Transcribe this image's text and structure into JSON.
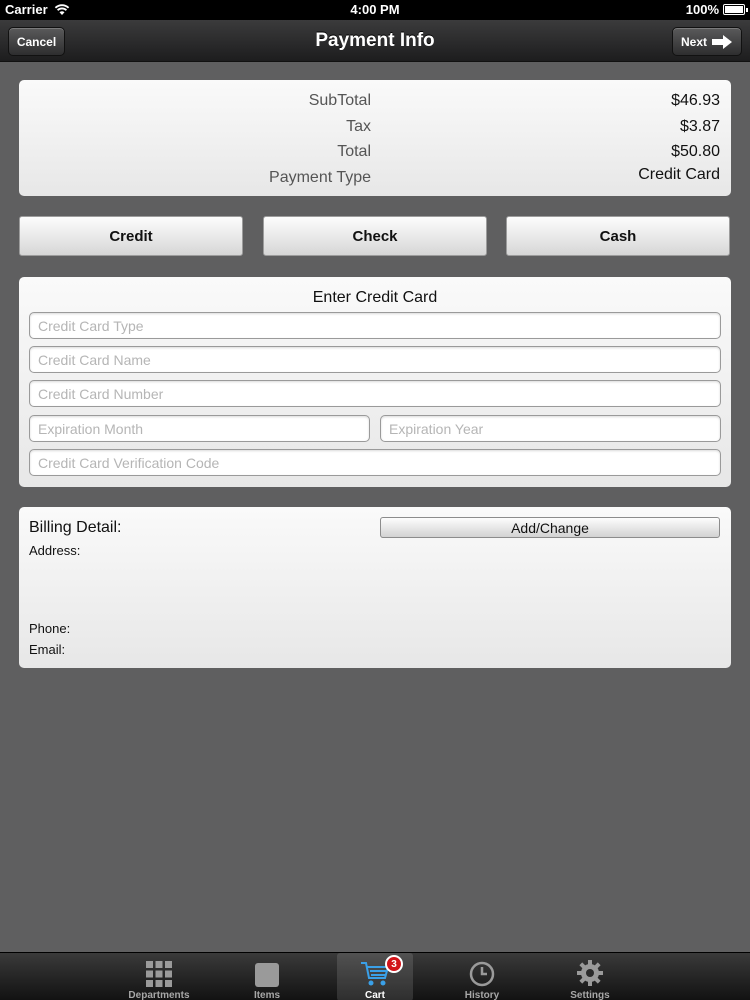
{
  "status_bar": {
    "carrier": "Carrier",
    "time": "4:00 PM",
    "battery": "100%"
  },
  "nav": {
    "title": "Payment Info",
    "cancel_label": "Cancel",
    "next_label": "Next"
  },
  "summary": {
    "rows": [
      {
        "label": "SubTotal",
        "value": "$46.93"
      },
      {
        "label": "Tax",
        "value": "$3.87"
      },
      {
        "label": "Total",
        "value": "$50.80"
      },
      {
        "label": "Payment Type",
        "value": "Credit Card"
      }
    ]
  },
  "payment_types": [
    "Credit",
    "Check",
    "Cash"
  ],
  "credit_card": {
    "title": "Enter Credit Card",
    "type_placeholder": "Credit Card Type",
    "name_placeholder": "Credit Card Name",
    "number_placeholder": "Credit Card Number",
    "month_placeholder": "Expiration Month",
    "year_placeholder": "Expiration Year",
    "cvc_placeholder": "Credit Card Verification Code"
  },
  "billing": {
    "title": "Billing Detail:",
    "add_change_label": "Add/Change",
    "address_label": "Address:",
    "phone_label": "Phone:",
    "email_label": "Email:"
  },
  "tab_bar": {
    "items": [
      {
        "label": "Departments",
        "icon": "grid-icon"
      },
      {
        "label": "Items",
        "icon": "square-icon"
      },
      {
        "label": "Cart",
        "icon": "cart-icon",
        "badge": "3"
      },
      {
        "label": "History",
        "icon": "clock-icon"
      },
      {
        "label": "Settings",
        "icon": "gear-icon"
      }
    ]
  },
  "colors": {
    "background": "#5f5f60",
    "badge": "#d2141a"
  }
}
